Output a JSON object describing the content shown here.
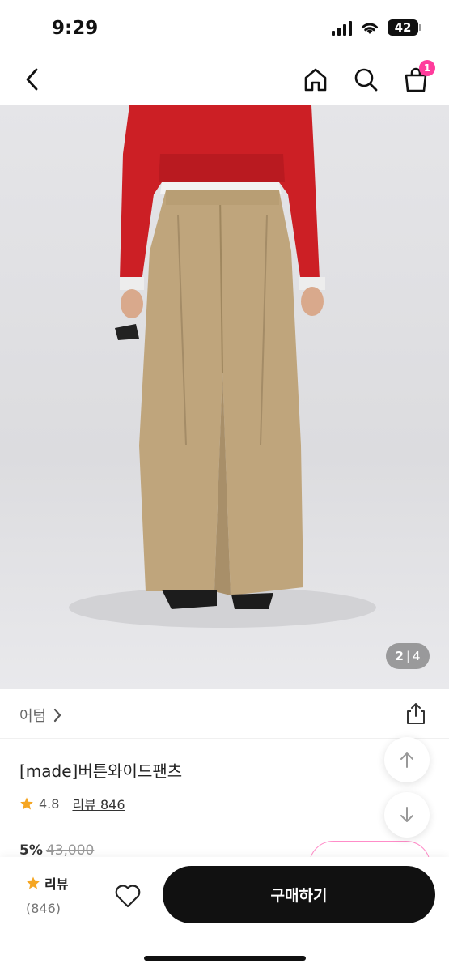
{
  "status_bar": {
    "time": "9:29",
    "battery": "42"
  },
  "nav": {
    "cart_count": "1"
  },
  "image": {
    "current": "2",
    "separator": "|",
    "total": "4"
  },
  "brand": {
    "name": "어텀"
  },
  "product": {
    "name": "[made]버튼와이드팬츠",
    "rating": "4.8",
    "review_label": "리뷰 846",
    "discount": "5%",
    "original_price": "43,000"
  },
  "bottom_bar": {
    "review_label": "리뷰",
    "review_count": "(846)",
    "buy_label": "구매하기"
  },
  "colors": {
    "accent_pink": "#ff3c9c",
    "star": "#f5a623",
    "buy_button": "#111111"
  }
}
